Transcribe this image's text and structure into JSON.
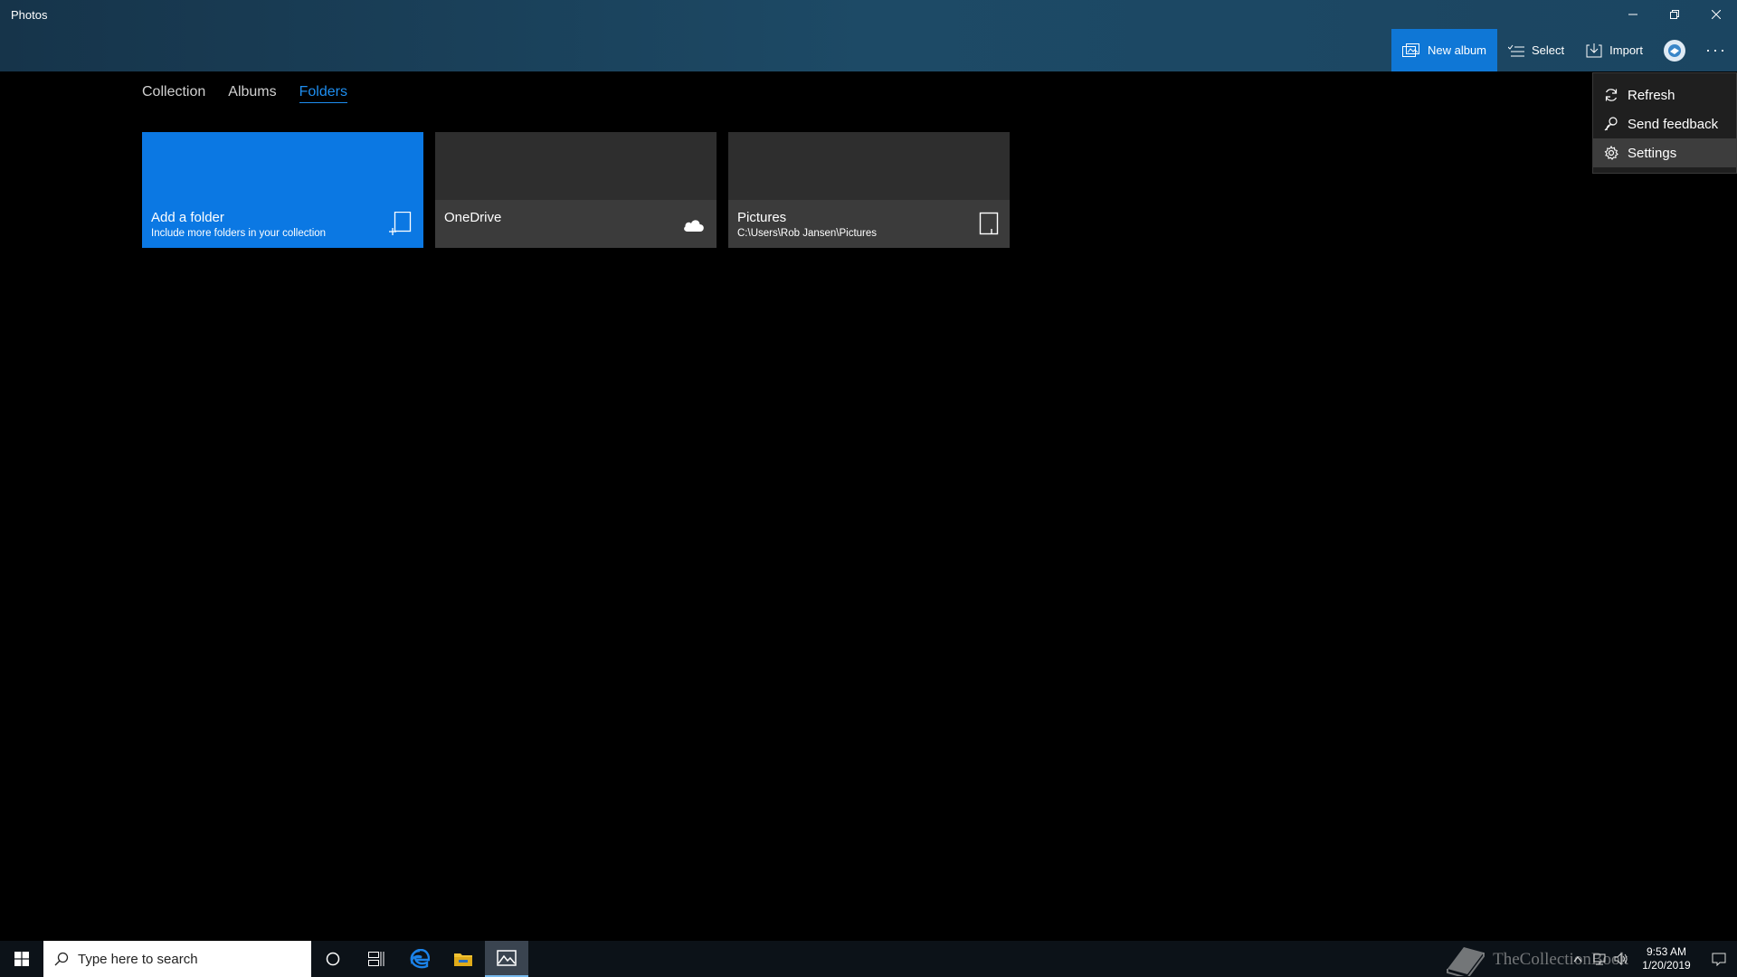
{
  "app": {
    "title": "Photos"
  },
  "window_controls": {
    "minimize_icon": "minimize-icon",
    "restore_icon": "restore-icon",
    "close_icon": "close-icon"
  },
  "toolbar": {
    "new_album_label": "New album",
    "select_label": "Select",
    "import_label": "Import",
    "more_label": "···"
  },
  "tabs": [
    {
      "label": "Collection",
      "active": false
    },
    {
      "label": "Albums",
      "active": false
    },
    {
      "label": "Folders",
      "active": true
    }
  ],
  "tiles": [
    {
      "title": "Add a folder",
      "subtitle": "Include more folders in your collection",
      "icon": "add-folder-icon"
    },
    {
      "title": "OneDrive",
      "subtitle": "",
      "icon": "cloud-icon"
    },
    {
      "title": "Pictures",
      "subtitle": "C:\\Users\\Rob Jansen\\Pictures",
      "icon": "device-icon"
    }
  ],
  "menu": {
    "items": [
      {
        "label": "Refresh",
        "icon": "refresh-icon"
      },
      {
        "label": "Send feedback",
        "icon": "feedback-icon"
      },
      {
        "label": "Settings",
        "icon": "gear-icon",
        "hovered": true
      }
    ]
  },
  "taskbar": {
    "search_placeholder": "Type here to search",
    "clock_time": "9:53 AM",
    "clock_date": "1/20/2019",
    "watermark": "TheCollectionBook"
  },
  "colors": {
    "accent": "#0b78e3",
    "active_tab": "#1e8ef0",
    "header": "#1d4a66"
  }
}
